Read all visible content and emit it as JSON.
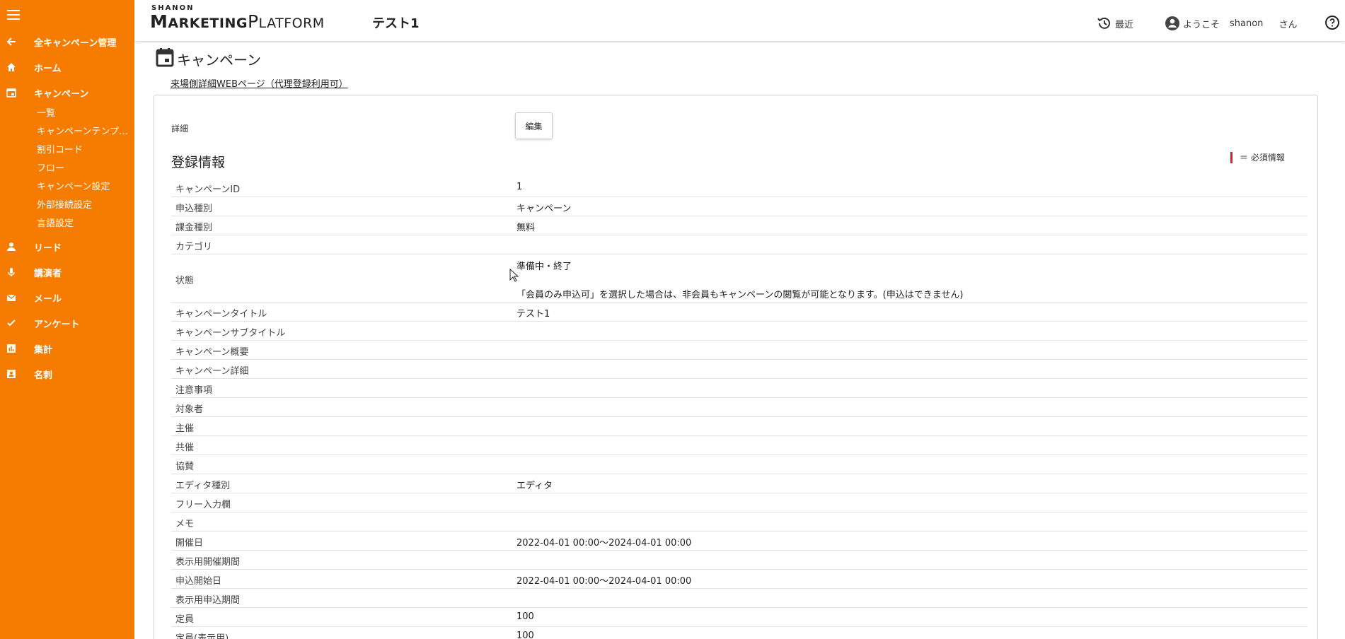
{
  "colors": {
    "sidebar_bg": "#f57c00",
    "required_bar": "#c62828"
  },
  "sidebar": {
    "menu_icon": "hamburger-icon",
    "items": [
      {
        "label": "全キャンペーン管理",
        "icon": "arrow-left-icon"
      },
      {
        "label": "ホーム",
        "icon": "home-icon"
      },
      {
        "label": "キャンペーン",
        "icon": "calendar-icon"
      },
      {
        "label": "リード",
        "icon": "person-icon"
      },
      {
        "label": "講演者",
        "icon": "mic-icon"
      },
      {
        "label": "メール",
        "icon": "mail-icon"
      },
      {
        "label": "アンケート",
        "icon": "check-icon"
      },
      {
        "label": "集計",
        "icon": "chart-icon"
      },
      {
        "label": "名刺",
        "icon": "badge-icon"
      }
    ],
    "sub_items": [
      {
        "label": "一覧"
      },
      {
        "label": "キャンペーンテンプレート"
      },
      {
        "label": "割引コード"
      },
      {
        "label": "フロー"
      },
      {
        "label": "キャンペーン設定"
      },
      {
        "label": "外部接続設定"
      },
      {
        "label": "言語設定"
      }
    ]
  },
  "header": {
    "logo_top": "SHANON",
    "logo_part1": "M",
    "logo_part2": "ARKETING",
    "logo_part3": "P",
    "logo_part4": "LATFORM",
    "page_name": "テスト1",
    "recent_label": "最近",
    "welcome_label": "ようこそ",
    "user_name": "shanon",
    "user_suffix": "さん"
  },
  "main": {
    "title": "キャンペーン",
    "sub_link": "来場側詳細WEBページ（代理登録利用可）",
    "detail_label": "詳細",
    "edit_button": "編集",
    "section_title": "登録情報",
    "required_note": "＝ 必須情報",
    "rows": [
      {
        "key": "キャンペーンID",
        "value": "1"
      },
      {
        "key": "申込種別",
        "value": "キャンペーン"
      },
      {
        "key": "課金種別",
        "value": "無料"
      },
      {
        "key": "カテゴリ",
        "value": ""
      },
      {
        "key": "状態",
        "value": "準備中・終了",
        "note": "「会員のみ申込可」を選択した場合は、非会員もキャンペーンの閲覧が可能となります。(申込はできません)"
      },
      {
        "key": "キャンペーンタイトル",
        "value": "テスト1"
      },
      {
        "key": "キャンペーンサブタイトル",
        "value": ""
      },
      {
        "key": "キャンペーン概要",
        "value": ""
      },
      {
        "key": "キャンペーン詳細",
        "value": ""
      },
      {
        "key": "注意事項",
        "value": ""
      },
      {
        "key": "対象者",
        "value": ""
      },
      {
        "key": "主催",
        "value": ""
      },
      {
        "key": "共催",
        "value": ""
      },
      {
        "key": "協賛",
        "value": ""
      },
      {
        "key": "エディタ種別",
        "value": "エディタ"
      },
      {
        "key": "フリー入力欄",
        "value": ""
      },
      {
        "key": "メモ",
        "value": ""
      },
      {
        "key": "開催日",
        "value": "2022-04-01 00:00～2024-04-01 00:00"
      },
      {
        "key": "表示用開催期間",
        "value": ""
      },
      {
        "key": "申込開始日",
        "value": "2022-04-01 00:00～2024-04-01 00:00"
      },
      {
        "key": "表示用申込期間",
        "value": ""
      },
      {
        "key": "定員",
        "value": "100"
      },
      {
        "key": "定員(表示用)",
        "value": "100"
      }
    ]
  }
}
